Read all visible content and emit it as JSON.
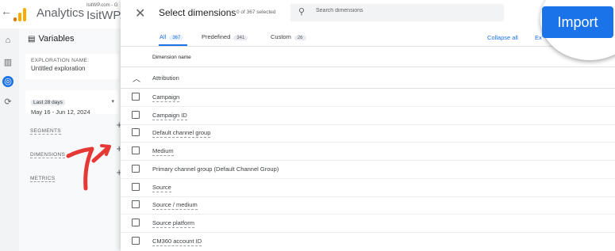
{
  "app": {
    "name": "Analytics",
    "account_small": "IsitWP.com - G",
    "account_name": "IsitWP.c"
  },
  "variables": {
    "title": "Variables",
    "exploration_label": "EXPLORATION NAME:",
    "exploration_value": "Untitled exploration",
    "date_chip": "Last 28 days",
    "date_range": "May 16 - Jun 12, 2024",
    "segments_label": "SEGMENTS",
    "dimensions_label": "DIMENSIONS",
    "metrics_label": "METRICS"
  },
  "dialog": {
    "title": "Select dimensions",
    "selected_count": "0 of 367 selected",
    "search_placeholder": "Search dimensions",
    "tabs": [
      {
        "label": "All",
        "count": "367"
      },
      {
        "label": "Predefined",
        "count": "341"
      },
      {
        "label": "Custom",
        "count": "26"
      }
    ],
    "collapse_all": "Collapse all",
    "expand_all": "Ex",
    "column_header": "Dimension name",
    "group": "Attribution",
    "dimensions": [
      "Campaign",
      "Campaign ID",
      "Default channel group",
      "Medium",
      "Primary channel group (Default Channel Group)",
      "Source",
      "Source / medium",
      "Source platform",
      "CM360 account ID"
    ],
    "import_label": "Import"
  },
  "colors": {
    "accent": "#1a73e8",
    "annotation": "#e53935"
  }
}
